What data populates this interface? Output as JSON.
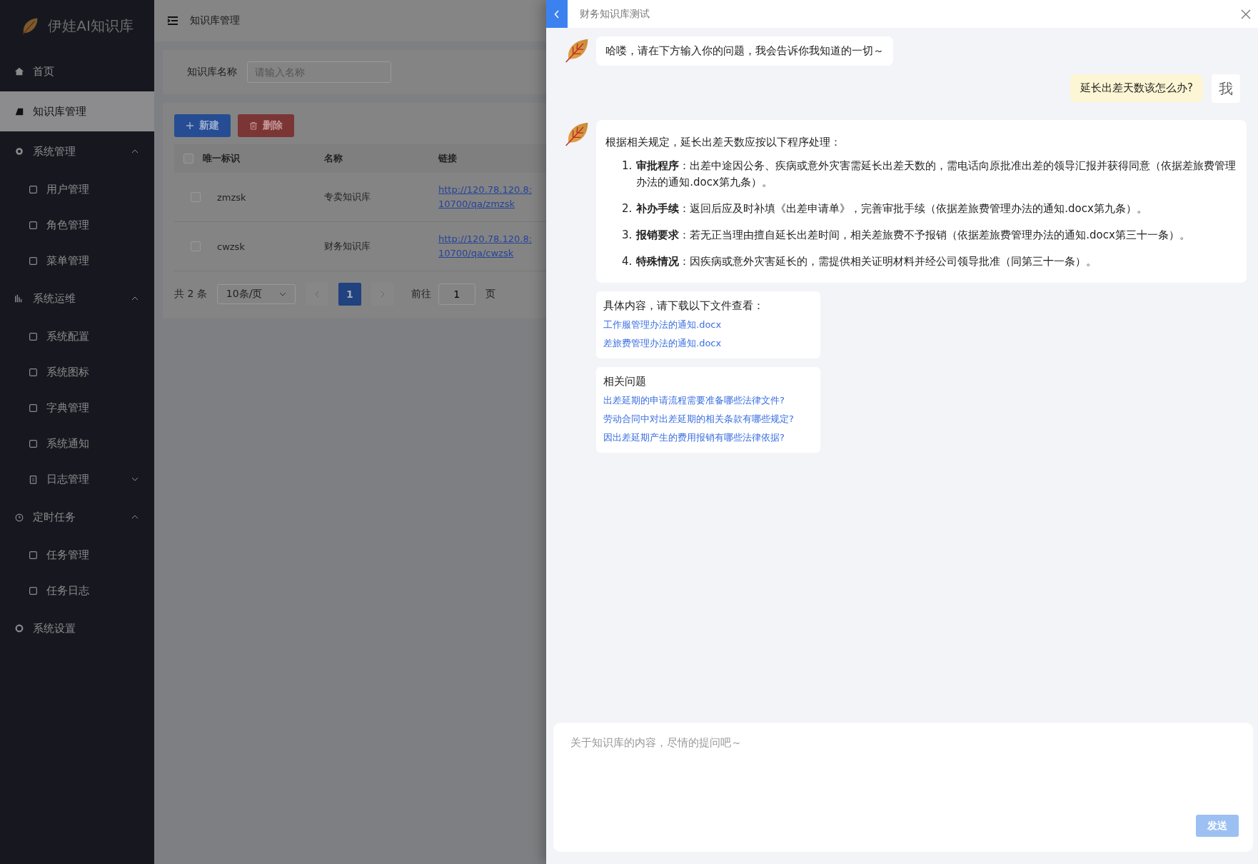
{
  "sidebar": {
    "logo_text": "伊娃AI知识库",
    "items": [
      {
        "kind": "item",
        "label": "首页",
        "selected": false
      },
      {
        "kind": "item",
        "label": "知识库管理",
        "selected": true
      },
      {
        "kind": "group",
        "label": "系统管理",
        "expanded": true,
        "children": [
          {
            "kind": "item",
            "label": "用户管理",
            "selected": false
          },
          {
            "kind": "item",
            "label": "角色管理",
            "selected": false
          },
          {
            "kind": "item",
            "label": "菜单管理",
            "selected": false
          }
        ]
      },
      {
        "kind": "group",
        "label": "系统运维",
        "expanded": true,
        "children": [
          {
            "kind": "item",
            "label": "系统配置",
            "selected": false
          },
          {
            "kind": "item",
            "label": "系统图标",
            "selected": false
          },
          {
            "kind": "item",
            "label": "字典管理",
            "selected": false
          },
          {
            "kind": "item",
            "label": "系统通知",
            "selected": false
          },
          {
            "kind": "group",
            "label": "日志管理",
            "expanded": false
          }
        ]
      },
      {
        "kind": "group",
        "label": "定时任务",
        "expanded": true,
        "children": [
          {
            "kind": "item",
            "label": "任务管理",
            "selected": false
          },
          {
            "kind": "item",
            "label": "任务日志",
            "selected": false
          }
        ]
      },
      {
        "kind": "item",
        "label": "系统设置",
        "selected": false
      }
    ]
  },
  "header": {
    "breadcrumb": "知识库管理"
  },
  "search": {
    "label": "知识库名称",
    "placeholder": "请输入名称"
  },
  "toolbar": [
    {
      "kind": "primary",
      "label": "新建"
    },
    {
      "kind": "danger",
      "label": "删除"
    }
  ],
  "table": {
    "all_checked": false,
    "columns": [
      "唯一标识",
      "名称",
      "链接"
    ],
    "rows": [
      {
        "checked": false,
        "cells": [
          "zmzsk",
          "专卖知识库",
          "http://120.78.120.8:10700/qa/zmzsk"
        ]
      },
      {
        "checked": false,
        "cells": [
          "cwzsk",
          "财务知识库",
          "http://120.78.120.8:10700/qa/cwzsk"
        ]
      }
    ]
  },
  "pagination": {
    "total": "共 2 条",
    "page_size": "10条/页",
    "pages": [
      {
        "label": "1",
        "selected": true
      }
    ],
    "goto_label": "前往",
    "goto_value": "1",
    "goto_suffix": "页"
  },
  "drawer": {
    "title": "财务知识库测试",
    "messages": [
      {
        "kind": "bot",
        "text": "哈喽，请在下方输入你的问题，我会告诉你我知道的一切～"
      },
      {
        "kind": "user",
        "text": "延长出差天数该怎么办?",
        "avatar": "我"
      },
      {
        "kind": "answer",
        "intro": "根据相关规定，延长出差天数应按以下程序处理：",
        "points": [
          {
            "number": "1.",
            "text": "**审批程序**：出差中途因公务、疾病或意外灾害需延长出差天数的，需电话向原批准出差的领导汇报并获得同意（依据差旅费管理办法的通知.docx第九条）。"
          },
          {
            "number": "2.",
            "text": "**补办手续**：返回后应及时补填《出差申请单》，完善审批手续（依据差旅费管理办法的通知.docx第九条）。"
          },
          {
            "number": "3.",
            "text": "**报销要求**：若无正当理由擅自延长出差时间，相关差旅费不予报销（依据差旅费管理办法的通知.docx第三十一条）。"
          },
          {
            "number": "4.",
            "text": "**特殊情况**：因疾病或意外灾害延长的，需提供相关证明材料并经公司领导批准（同第三十一条）。"
          }
        ]
      },
      {
        "kind": "files",
        "title": "具体内容，请下载以下文件查看：",
        "links": [
          "工作服管理办法的通知.docx",
          "差旅费管理办法的通知.docx"
        ]
      },
      {
        "kind": "related",
        "title": "相关问题",
        "links": [
          "出差延期的申请流程需要准备哪些法律文件?",
          "劳动合同中对出差延期的相关条款有哪些规定?",
          "因出差延期产生的费用报销有哪些法律依据?"
        ]
      }
    ],
    "input": {
      "placeholder": "关于知识库的内容，尽情的提问吧～",
      "send_label": "发送",
      "send_disabled": true
    }
  }
}
